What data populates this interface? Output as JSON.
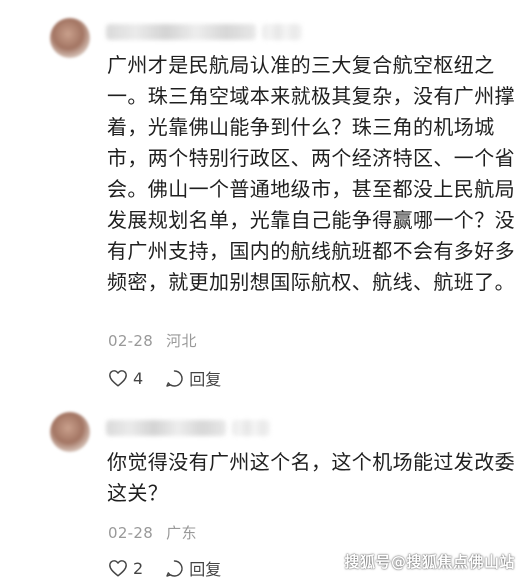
{
  "comments": [
    {
      "text": "广州才是民航局认准的三大复合航空枢纽之一。珠三角空域本来就极其复杂，没有广州撑着，光靠佛山能争到什么？珠三角的机场城市，两个特别行政区、两个经济特区、一个省会。佛山一个普通地级市，甚至都没上民航局发展规划名单，光靠自己能争得赢哪一个？没有广州支持，国内的航线航班都不会有多好多频密，就更加别想国际航权、航线、航班了。",
      "date": "02-28",
      "location": "河北",
      "likes": "4",
      "reply_label": "回复"
    },
    {
      "text": "你觉得没有广州这个名，这个机场能过发改委这关？",
      "date": "02-28",
      "location": "广东",
      "likes": "2",
      "reply_label": "回复"
    }
  ],
  "watermark": "搜狐号@搜狐焦点佛山站"
}
